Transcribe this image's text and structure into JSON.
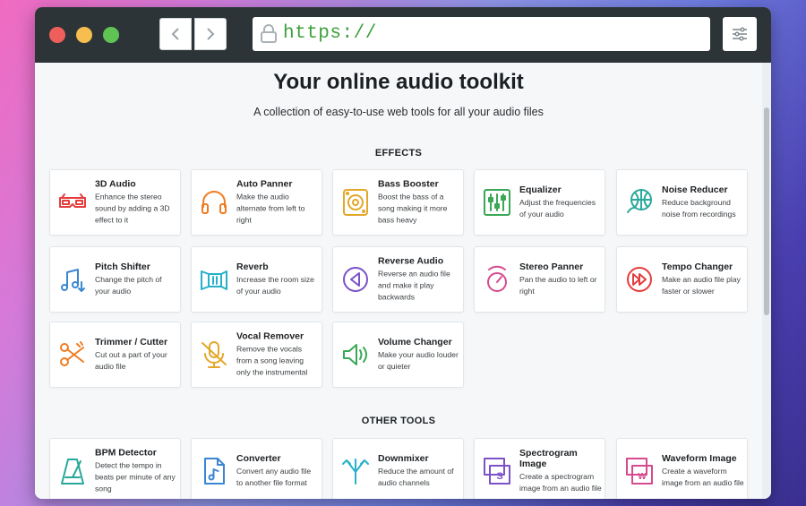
{
  "browser": {
    "url": "https://"
  },
  "hero": {
    "title": "Your online audio toolkit",
    "subtitle": "A collection of easy-to-use web tools for all your audio files"
  },
  "sections": {
    "effects": "EFFECTS",
    "other": "OTHER TOOLS"
  },
  "effects": [
    {
      "name": "3D Audio",
      "desc": "Enhance the stereo sound by adding a 3D effect to it",
      "icon": "3d-glasses-icon",
      "color": "#e53d3d"
    },
    {
      "name": "Auto Panner",
      "desc": "Make the audio alternate from left to right",
      "icon": "headphones-icon",
      "color": "#ef7c22"
    },
    {
      "name": "Bass Booster",
      "desc": "Boost the bass of a song making it more bass heavy",
      "icon": "speaker-icon",
      "color": "#e3a72a"
    },
    {
      "name": "Equalizer",
      "desc": "Adjust the frequencies of your audio",
      "icon": "equalizer-icon",
      "color": "#3aa856"
    },
    {
      "name": "Noise Reducer",
      "desc": "Reduce background noise from recordings",
      "icon": "globe-icon",
      "color": "#2aa89a"
    },
    {
      "name": "Pitch Shifter",
      "desc": "Change the pitch of your audio",
      "icon": "music-notes-icon",
      "color": "#3b86d1"
    },
    {
      "name": "Reverb",
      "desc": "Increase the room size of your audio",
      "icon": "room-icon",
      "color": "#27b1c9"
    },
    {
      "name": "Reverse Audio",
      "desc": "Reverse an audio file and make it play backwards",
      "icon": "reverse-play-icon",
      "color": "#7b52c9"
    },
    {
      "name": "Stereo Panner",
      "desc": "Pan the audio to left or right",
      "icon": "pan-knob-icon",
      "color": "#d64a8e"
    },
    {
      "name": "Tempo Changer",
      "desc": "Make an audio file play faster or slower",
      "icon": "fast-forward-icon",
      "color": "#e53d3d"
    },
    {
      "name": "Trimmer / Cutter",
      "desc": "Cut out a part of your audio file",
      "icon": "scissors-icon",
      "color": "#ef7c22"
    },
    {
      "name": "Vocal Remover",
      "desc": "Remove the vocals from a song leaving only the instrumental",
      "icon": "muted-mic-icon",
      "color": "#e3a72a"
    },
    {
      "name": "Volume Changer",
      "desc": "Make your audio louder or quieter",
      "icon": "volume-icon",
      "color": "#3aa856"
    }
  ],
  "other_tools": [
    {
      "name": "BPM Detector",
      "desc": "Detect the tempo in beats per minute of any song",
      "icon": "metronome-icon",
      "color": "#2aa89a"
    },
    {
      "name": "Converter",
      "desc": "Convert any audio file to another file format",
      "icon": "music-file-icon",
      "color": "#3b86d1"
    },
    {
      "name": "Downmixer",
      "desc": "Reduce the amount of audio channels",
      "icon": "downmix-icon",
      "color": "#27b1c9"
    },
    {
      "name": "Spectrogram Image",
      "desc": "Create a spectrogram image from an audio file",
      "icon": "spectrogram-icon",
      "color": "#7b52c9"
    },
    {
      "name": "Waveform Image",
      "desc": "Create a waveform image from an audio file",
      "icon": "waveform-image-icon",
      "color": "#d64a8e"
    }
  ]
}
